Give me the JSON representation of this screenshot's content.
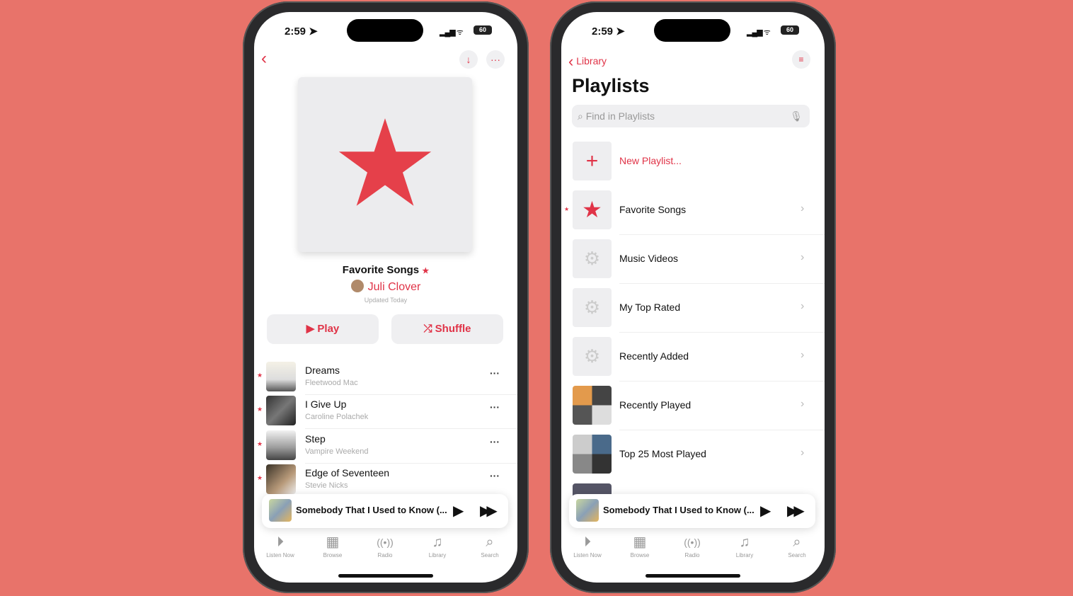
{
  "colors": {
    "background": "#e8736a",
    "accent": "#e03347"
  },
  "status": {
    "time": "2:59",
    "battery": "60"
  },
  "left": {
    "title": "Favorite Songs",
    "owner": "Juli Clover",
    "updated": "Updated Today",
    "play": "Play",
    "shuffle": "Shuffle",
    "songs": [
      {
        "title": "Dreams",
        "artist": "Fleetwood Mac"
      },
      {
        "title": "I Give Up",
        "artist": "Caroline Polachek"
      },
      {
        "title": "Step",
        "artist": "Vampire Weekend"
      },
      {
        "title": "Edge of Seventeen",
        "artist": "Stevie Nicks"
      }
    ]
  },
  "right": {
    "back": "Library",
    "title": "Playlists",
    "search_placeholder": "Find in Playlists",
    "new_playlist": "New Playlist...",
    "playlists": [
      "Favorite Songs",
      "Music Videos",
      "My Top Rated",
      "Recently Added",
      "Recently Played",
      "Top 25 Most Played"
    ]
  },
  "mini_player": {
    "title": "Somebody That I Used to Know (..."
  },
  "tabs": [
    "Listen Now",
    "Browse",
    "Radio",
    "Library",
    "Search"
  ]
}
